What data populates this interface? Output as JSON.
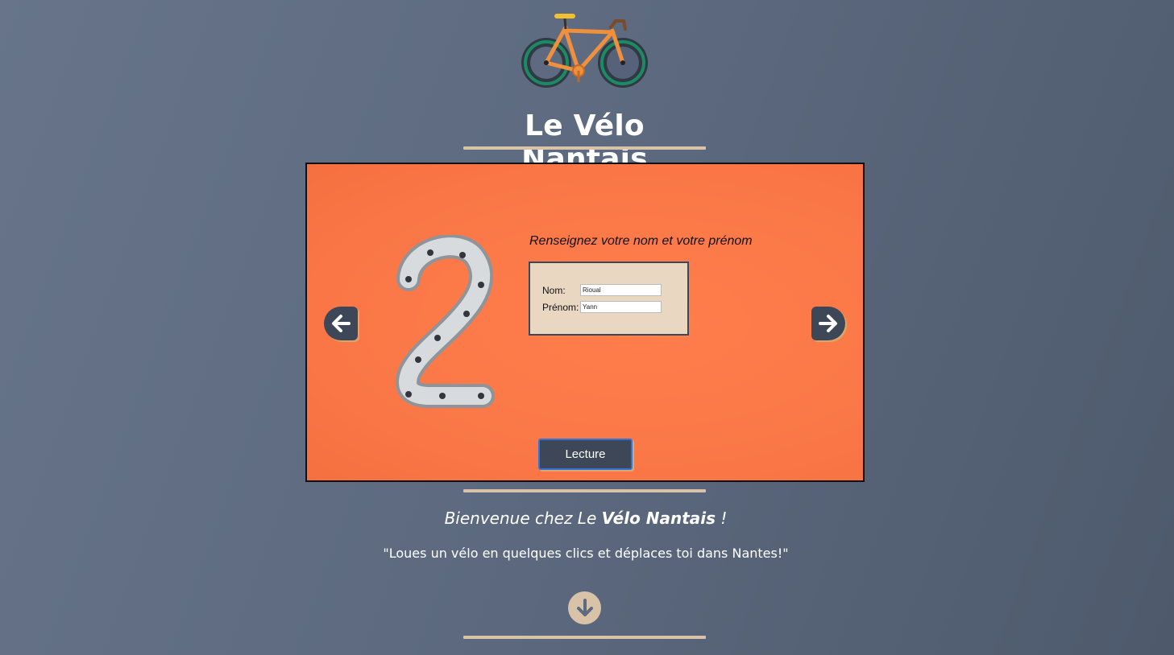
{
  "site": {
    "title": "Le Vélo Nantais"
  },
  "slider": {
    "instruction": "Renseignez votre nom et votre prénom",
    "form": {
      "nom_label": "Nom:",
      "nom_value": "Rioual",
      "prenom_label": "Prénom:",
      "prenom_value": "Yann"
    },
    "play_label": "Lecture",
    "step_number": "2"
  },
  "welcome": {
    "prefix": "Bienvenue chez Le ",
    "brand": "Vélo Nantais",
    "suffix": " !"
  },
  "tagline": "\"Loues un vélo en quelques clics et déplaces toi dans Nantes!\"",
  "icons": {
    "logo": "bicycle-icon",
    "prev": "arrow-left-icon",
    "next": "arrow-right-icon",
    "scroll": "arrow-down-icon"
  },
  "colors": {
    "accent": "#d9c3a8",
    "slide_bg": "#fb7848",
    "button_bg": "#3e4757"
  }
}
